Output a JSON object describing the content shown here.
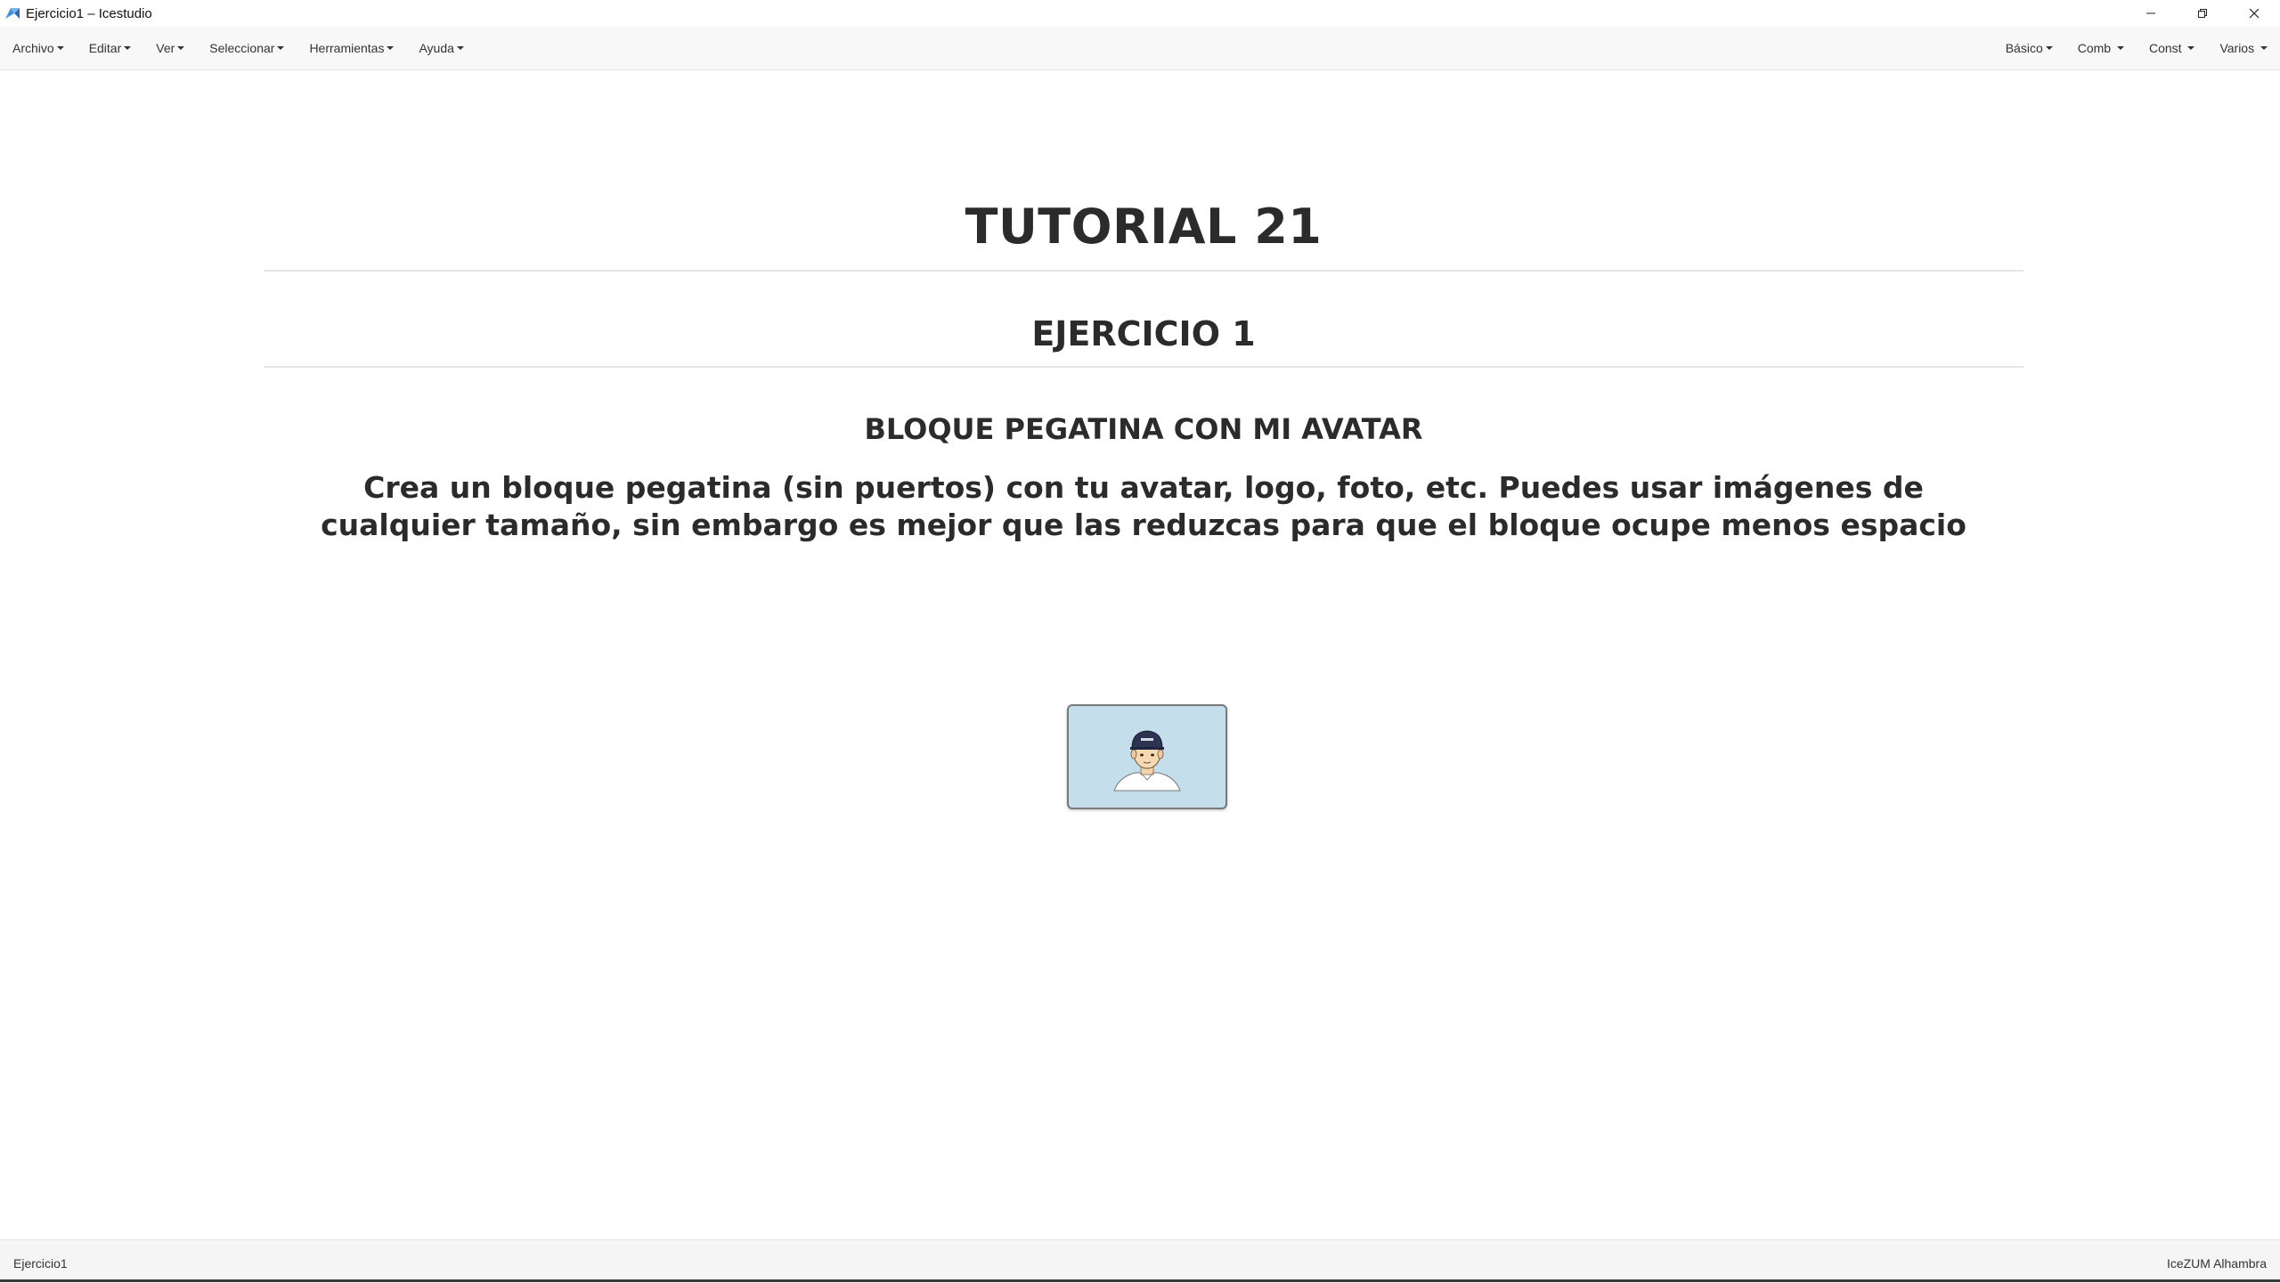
{
  "window": {
    "title": "Ejercicio1 – Icestudio",
    "icon": "icestudio-logo-icon",
    "controls": [
      "minimize-icon",
      "restore-icon",
      "close-icon"
    ]
  },
  "menu": {
    "left": [
      {
        "label": "Archivo"
      },
      {
        "label": "Editar"
      },
      {
        "label": "Ver"
      },
      {
        "label": "Seleccionar"
      },
      {
        "label": "Herramientas"
      },
      {
        "label": "Ayuda"
      }
    ],
    "right": [
      {
        "label": "Básico"
      },
      {
        "label": "Comb"
      },
      {
        "label": "Const"
      },
      {
        "label": "Varios"
      }
    ]
  },
  "content": {
    "title": "TUTORIAL 21",
    "subtitle": "EJERCICIO 1",
    "section": "BLOQUE PEGATINA CON MI AVATAR",
    "description": "Crea un bloque pegatina (sin puertos) con tu avatar, logo, foto, etc. Puedes usar imágenes de cualquier tamaño, sin embargo es mejor que las reduzcas para que el bloque ocupe menos espacio"
  },
  "sticker_block": {
    "image": "avatar-with-cap",
    "background_color": "#c4dfeb"
  },
  "status": {
    "project": "Ejercicio1",
    "board": "IceZUM Alhambra"
  }
}
